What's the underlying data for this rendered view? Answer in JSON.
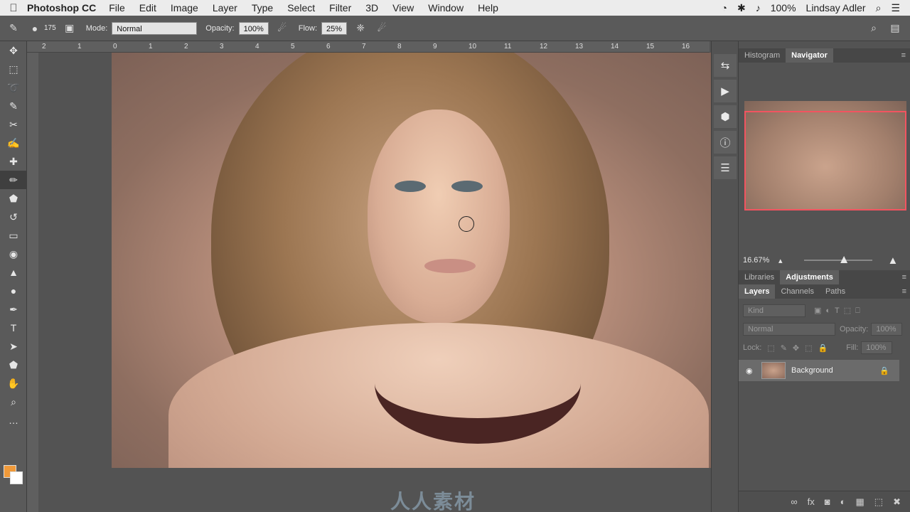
{
  "menubar": {
    "app_name": "Photoshop CC",
    "menus": [
      "File",
      "Edit",
      "Image",
      "Layer",
      "Type",
      "Select",
      "Filter",
      "3D",
      "View",
      "Window",
      "Help"
    ],
    "battery": "100%",
    "user": "Lindsay Adler"
  },
  "options": {
    "brush_size": "175",
    "mode_label": "Mode:",
    "mode_value": "Normal",
    "opacity_label": "Opacity:",
    "opacity_value": "100%",
    "flow_label": "Flow:",
    "flow_value": "25%"
  },
  "ruler_ticks": [
    "2",
    "1",
    "0",
    "1",
    "2",
    "3",
    "4",
    "5",
    "6",
    "7",
    "8",
    "9",
    "10",
    "11",
    "12",
    "13",
    "14",
    "15",
    "16"
  ],
  "tools": [
    "move",
    "marquee",
    "lasso",
    "quick-select",
    "crop",
    "eyedropper",
    "healing",
    "brush",
    "stamp",
    "history-brush",
    "eraser",
    "bucket",
    "sharpen",
    "dodge",
    "pen",
    "type",
    "path-select",
    "shape",
    "hand",
    "zoom",
    "more"
  ],
  "colors": {
    "foreground": "#f09a3a",
    "background": "#ffffff",
    "nav_frame": "#f25460"
  },
  "navigator": {
    "tabs": [
      "Histogram",
      "Navigator"
    ],
    "active_tab": "Navigator",
    "zoom": "16.67%",
    "zoom_slider_fraction": 0.6
  },
  "lib_tabs": [
    "Libraries",
    "Adjustments"
  ],
  "layers_panel": {
    "tabs": [
      "Layers",
      "Channels",
      "Paths"
    ],
    "kind_placeholder": "Kind",
    "blend_mode": "Normal",
    "opacity_label": "Opacity:",
    "opacity_value": "100%",
    "lock_label": "Lock:",
    "fill_label": "Fill:",
    "fill_value": "100%",
    "layer_name": "Background"
  },
  "watermark": "人人素材"
}
